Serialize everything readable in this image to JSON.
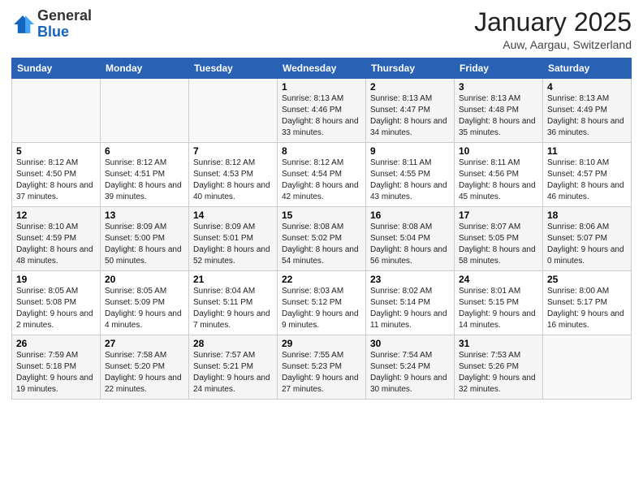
{
  "logo": {
    "general": "General",
    "blue": "Blue"
  },
  "title": "January 2025",
  "subtitle": "Auw, Aargau, Switzerland",
  "weekdays": [
    "Sunday",
    "Monday",
    "Tuesday",
    "Wednesday",
    "Thursday",
    "Friday",
    "Saturday"
  ],
  "rows": [
    [
      {
        "day": "",
        "info": ""
      },
      {
        "day": "",
        "info": ""
      },
      {
        "day": "",
        "info": ""
      },
      {
        "day": "1",
        "info": "Sunrise: 8:13 AM\nSunset: 4:46 PM\nDaylight: 8 hours\nand 33 minutes."
      },
      {
        "day": "2",
        "info": "Sunrise: 8:13 AM\nSunset: 4:47 PM\nDaylight: 8 hours\nand 34 minutes."
      },
      {
        "day": "3",
        "info": "Sunrise: 8:13 AM\nSunset: 4:48 PM\nDaylight: 8 hours\nand 35 minutes."
      },
      {
        "day": "4",
        "info": "Sunrise: 8:13 AM\nSunset: 4:49 PM\nDaylight: 8 hours\nand 36 minutes."
      }
    ],
    [
      {
        "day": "5",
        "info": "Sunrise: 8:12 AM\nSunset: 4:50 PM\nDaylight: 8 hours\nand 37 minutes."
      },
      {
        "day": "6",
        "info": "Sunrise: 8:12 AM\nSunset: 4:51 PM\nDaylight: 8 hours\nand 39 minutes."
      },
      {
        "day": "7",
        "info": "Sunrise: 8:12 AM\nSunset: 4:53 PM\nDaylight: 8 hours\nand 40 minutes."
      },
      {
        "day": "8",
        "info": "Sunrise: 8:12 AM\nSunset: 4:54 PM\nDaylight: 8 hours\nand 42 minutes."
      },
      {
        "day": "9",
        "info": "Sunrise: 8:11 AM\nSunset: 4:55 PM\nDaylight: 8 hours\nand 43 minutes."
      },
      {
        "day": "10",
        "info": "Sunrise: 8:11 AM\nSunset: 4:56 PM\nDaylight: 8 hours\nand 45 minutes."
      },
      {
        "day": "11",
        "info": "Sunrise: 8:10 AM\nSunset: 4:57 PM\nDaylight: 8 hours\nand 46 minutes."
      }
    ],
    [
      {
        "day": "12",
        "info": "Sunrise: 8:10 AM\nSunset: 4:59 PM\nDaylight: 8 hours\nand 48 minutes."
      },
      {
        "day": "13",
        "info": "Sunrise: 8:09 AM\nSunset: 5:00 PM\nDaylight: 8 hours\nand 50 minutes."
      },
      {
        "day": "14",
        "info": "Sunrise: 8:09 AM\nSunset: 5:01 PM\nDaylight: 8 hours\nand 52 minutes."
      },
      {
        "day": "15",
        "info": "Sunrise: 8:08 AM\nSunset: 5:02 PM\nDaylight: 8 hours\nand 54 minutes."
      },
      {
        "day": "16",
        "info": "Sunrise: 8:08 AM\nSunset: 5:04 PM\nDaylight: 8 hours\nand 56 minutes."
      },
      {
        "day": "17",
        "info": "Sunrise: 8:07 AM\nSunset: 5:05 PM\nDaylight: 8 hours\nand 58 minutes."
      },
      {
        "day": "18",
        "info": "Sunrise: 8:06 AM\nSunset: 5:07 PM\nDaylight: 9 hours\nand 0 minutes."
      }
    ],
    [
      {
        "day": "19",
        "info": "Sunrise: 8:05 AM\nSunset: 5:08 PM\nDaylight: 9 hours\nand 2 minutes."
      },
      {
        "day": "20",
        "info": "Sunrise: 8:05 AM\nSunset: 5:09 PM\nDaylight: 9 hours\nand 4 minutes."
      },
      {
        "day": "21",
        "info": "Sunrise: 8:04 AM\nSunset: 5:11 PM\nDaylight: 9 hours\nand 7 minutes."
      },
      {
        "day": "22",
        "info": "Sunrise: 8:03 AM\nSunset: 5:12 PM\nDaylight: 9 hours\nand 9 minutes."
      },
      {
        "day": "23",
        "info": "Sunrise: 8:02 AM\nSunset: 5:14 PM\nDaylight: 9 hours\nand 11 minutes."
      },
      {
        "day": "24",
        "info": "Sunrise: 8:01 AM\nSunset: 5:15 PM\nDaylight: 9 hours\nand 14 minutes."
      },
      {
        "day": "25",
        "info": "Sunrise: 8:00 AM\nSunset: 5:17 PM\nDaylight: 9 hours\nand 16 minutes."
      }
    ],
    [
      {
        "day": "26",
        "info": "Sunrise: 7:59 AM\nSunset: 5:18 PM\nDaylight: 9 hours\nand 19 minutes."
      },
      {
        "day": "27",
        "info": "Sunrise: 7:58 AM\nSunset: 5:20 PM\nDaylight: 9 hours\nand 22 minutes."
      },
      {
        "day": "28",
        "info": "Sunrise: 7:57 AM\nSunset: 5:21 PM\nDaylight: 9 hours\nand 24 minutes."
      },
      {
        "day": "29",
        "info": "Sunrise: 7:55 AM\nSunset: 5:23 PM\nDaylight: 9 hours\nand 27 minutes."
      },
      {
        "day": "30",
        "info": "Sunrise: 7:54 AM\nSunset: 5:24 PM\nDaylight: 9 hours\nand 30 minutes."
      },
      {
        "day": "31",
        "info": "Sunrise: 7:53 AM\nSunset: 5:26 PM\nDaylight: 9 hours\nand 32 minutes."
      },
      {
        "day": "",
        "info": ""
      }
    ]
  ]
}
